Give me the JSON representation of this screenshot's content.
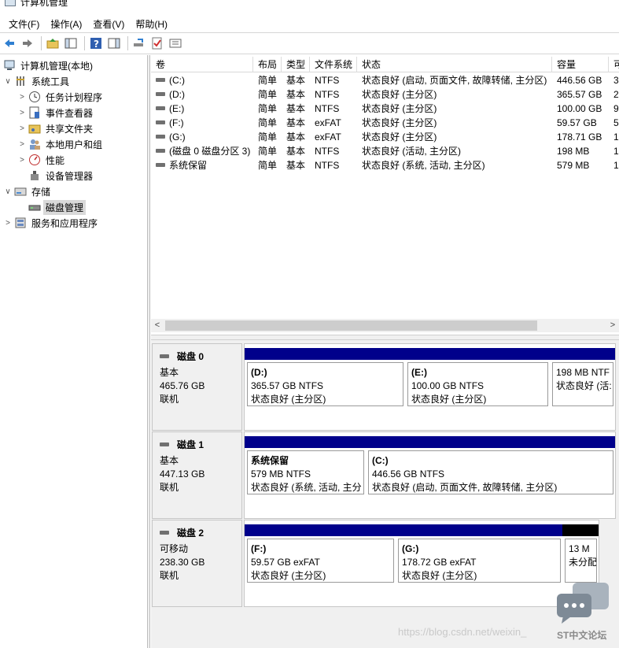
{
  "window": {
    "title": "计算机管理"
  },
  "menu": [
    "文件(F)",
    "操作(A)",
    "查看(V)",
    "帮助(H)"
  ],
  "toolbar_icons": [
    "back-arrow-icon",
    "forward-arrow-icon",
    "up-folder-icon",
    "show-hide-tree-icon",
    "help-icon",
    "action-pane-icon",
    "connect-drive-icon",
    "check-icon",
    "properties-icon"
  ],
  "tree": {
    "root": "计算机管理(本地)",
    "system_tools": "系统工具",
    "task_scheduler": "任务计划程序",
    "event_viewer": "事件查看器",
    "shared_folders": "共享文件夹",
    "local_users": "本地用户和组",
    "performance": "性能",
    "device_manager": "设备管理器",
    "storage": "存储",
    "disk_management": "磁盘管理",
    "services_apps": "服务和应用程序"
  },
  "volume_list": {
    "headers": [
      "卷",
      "布局",
      "类型",
      "文件系统",
      "状态",
      "容量",
      "可"
    ],
    "rows": [
      [
        "(C:)",
        "简单",
        "基本",
        "NTFS",
        "状态良好 (启动, 页面文件, 故障转储, 主分区)",
        "446.56 GB",
        "3"
      ],
      [
        "(D:)",
        "简单",
        "基本",
        "NTFS",
        "状态良好 (主分区)",
        "365.57 GB",
        "2"
      ],
      [
        "(E:)",
        "简单",
        "基本",
        "NTFS",
        "状态良好 (主分区)",
        "100.00 GB",
        "9"
      ],
      [
        "(F:)",
        "简单",
        "基本",
        "exFAT",
        "状态良好 (主分区)",
        "59.57 GB",
        "5"
      ],
      [
        "(G:)",
        "简单",
        "基本",
        "exFAT",
        "状态良好 (主分区)",
        "178.71 GB",
        "1"
      ],
      [
        "(磁盘 0 磁盘分区 3)",
        "简单",
        "基本",
        "NTFS",
        "状态良好 (活动, 主分区)",
        "198 MB",
        "1"
      ],
      [
        "系统保留",
        "简单",
        "基本",
        "NTFS",
        "状态良好 (系统, 活动, 主分区)",
        "579 MB",
        "1"
      ]
    ]
  },
  "disks": [
    {
      "name": "磁盘 0",
      "type": "基本",
      "size": "465.76 GB",
      "status": "联机",
      "partitions": [
        {
          "name": "(D:)",
          "size": "365.57 GB NTFS",
          "status": "状态良好 (主分区)"
        },
        {
          "name": "(E:)",
          "size": "100.00 GB NTFS",
          "status": "状态良好 (主分区)"
        },
        {
          "name": "",
          "size": "198 MB NTF",
          "status": "状态良好 (活:"
        }
      ]
    },
    {
      "name": "磁盘 1",
      "type": "基本",
      "size": "447.13 GB",
      "status": "联机",
      "partitions": [
        {
          "name": "系统保留",
          "size": "579 MB NTFS",
          "status": "状态良好 (系统, 活动, 主分"
        },
        {
          "name": "(C:)",
          "size": "446.56 GB NTFS",
          "status": "状态良好 (启动, 页面文件, 故障转储, 主分区)"
        }
      ]
    },
    {
      "name": "磁盘 2",
      "type": "可移动",
      "size": "238.30 GB",
      "status": "联机",
      "partitions": [
        {
          "name": "(F:)",
          "size": "59.57 GB exFAT",
          "status": "状态良好 (主分区)"
        },
        {
          "name": "(G:)",
          "size": "178.72 GB exFAT",
          "status": "状态良好 (主分区)"
        },
        {
          "name": "",
          "size": "13 M",
          "status": "未分配"
        }
      ]
    }
  ],
  "watermark": {
    "url": "https://blog.csdn.net/weixin_",
    "brand": "ST中文论坛"
  },
  "colors": {
    "primary_partition": "#00008b",
    "unallocated": "#000000",
    "selection": "#d9d9d9"
  }
}
